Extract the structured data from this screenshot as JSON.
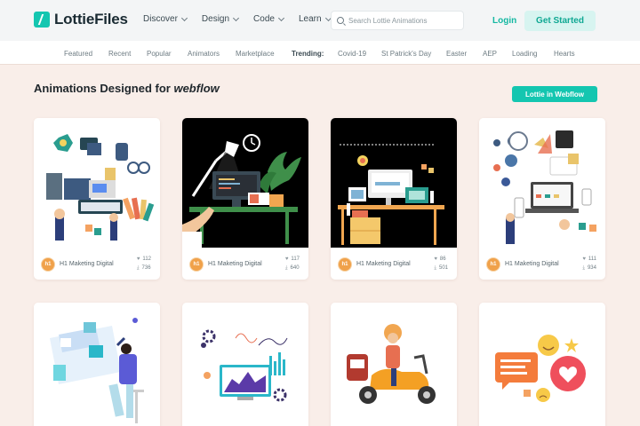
{
  "header": {
    "logo_text": "LottieFiles",
    "nav": [
      "Discover",
      "Design",
      "Code",
      "Learn"
    ],
    "search_placeholder": "Search Lottie Animations",
    "login_label": "Login",
    "get_started_label": "Get Started"
  },
  "categories": {
    "items": [
      "Featured",
      "Recent",
      "Popular",
      "Animators",
      "Marketplace"
    ],
    "trending_label": "Trending:",
    "trending": [
      "Covid-19",
      "St Patrick's Day",
      "Easter",
      "AEP",
      "Loading",
      "Hearts"
    ]
  },
  "section": {
    "title_prefix": "Animations Designed for ",
    "title_brand": "webflow",
    "cta_label": "Lottie in Webflow"
  },
  "cards": [
    {
      "author": "H1 Maketing Digital",
      "avatar": "h1",
      "likes": "112",
      "downloads": "736",
      "bg": "#ffffff"
    },
    {
      "author": "H1 Maketing Digital",
      "avatar": "h1",
      "likes": "117",
      "downloads": "640",
      "bg": "#000000"
    },
    {
      "author": "H1 Maketing Digital",
      "avatar": "h1",
      "likes": "86",
      "downloads": "501",
      "bg": "#000000"
    },
    {
      "author": "H1 Maketing Digital",
      "avatar": "h1",
      "likes": "111",
      "downloads": "934",
      "bg": "#ffffff"
    },
    {
      "bg": "#ffffff"
    },
    {
      "bg": "#ffffff"
    },
    {
      "bg": "#ffffff"
    },
    {
      "bg": "#ffffff"
    }
  ],
  "colors": {
    "accent": "#14c6b0",
    "page_bg": "#f9eee9"
  }
}
